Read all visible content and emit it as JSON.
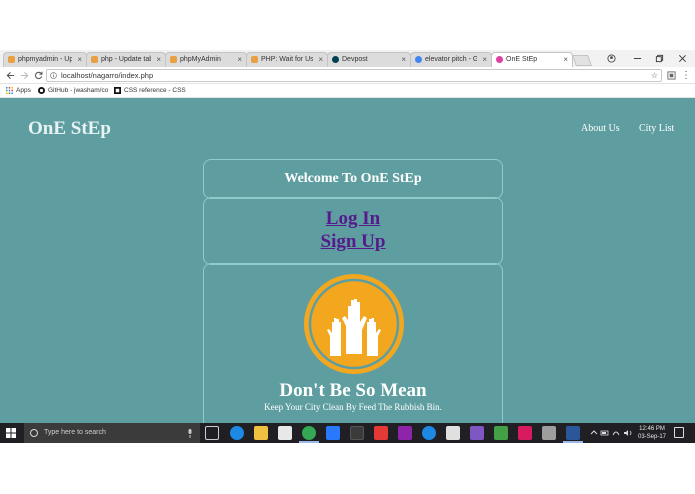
{
  "browser": {
    "tabs": [
      {
        "label": "phpmyadmin - Up",
        "icon_color": "#e8a042",
        "active": false
      },
      {
        "label": "php - Update tab",
        "icon_color": "#e8a042",
        "active": false
      },
      {
        "label": "phpMyAdmin",
        "icon_color": "#e8a042",
        "active": false
      },
      {
        "label": "PHP: Wait for Use",
        "icon_color": "#e8a042",
        "active": false
      },
      {
        "label": "Devpost",
        "icon_color": "#003e54",
        "active": false
      },
      {
        "label": "elevator pitch - G",
        "icon_color": "#4285f4",
        "active": false
      },
      {
        "label": "OnE StEp",
        "icon_color": "#e040a0",
        "active": true
      }
    ],
    "close_glyph": "×",
    "address": "localhost/nagarro/index.php",
    "bookmarks": [
      {
        "label": "Apps",
        "icon": "apps-grid-icon"
      },
      {
        "label": "GitHub - jwasham/co",
        "icon": "github-icon"
      },
      {
        "label": "CSS reference - CSS",
        "icon": "css-reference-icon"
      }
    ]
  },
  "site": {
    "brand": "OnE StEp",
    "nav": {
      "about": "About Us",
      "city_list": "City List"
    },
    "welcome": "Welcome To OnE StEp",
    "login": "Log In",
    "signup": "Sign Up",
    "hero_title": "Don't Be So Mean",
    "hero_subtitle": "Keep Your City Clean By Feed The Rubbish Bin."
  },
  "taskbar": {
    "search_placeholder": "Type here to search",
    "time": "12:46 PM",
    "date": "03-Sep-17"
  },
  "colors": {
    "page_bg": "#5f9ea0",
    "link_visited": "#551a8b",
    "logo_orange": "#f2a71f",
    "taskbar_bg": "#1f1f24"
  }
}
